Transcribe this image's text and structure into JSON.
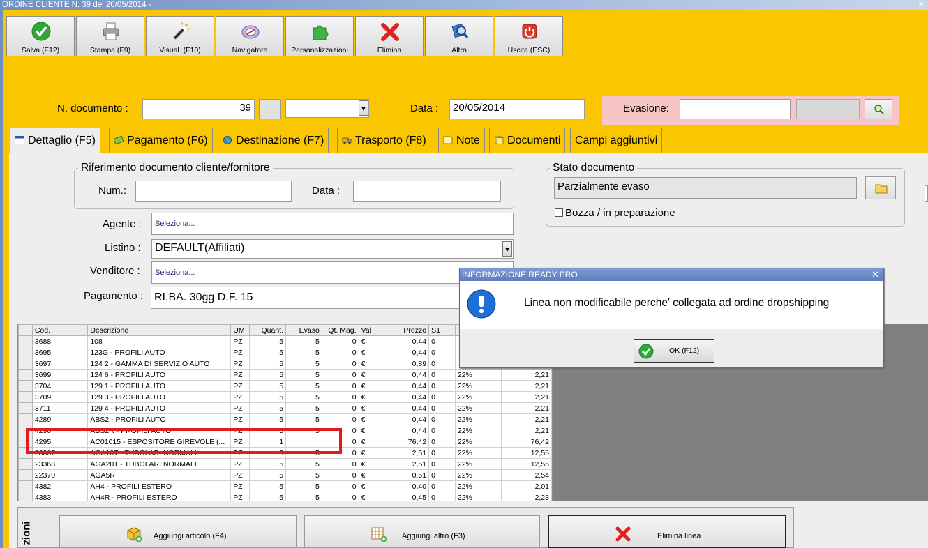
{
  "window": {
    "title": "ORDINE CLIENTE N. 39 del 20/05/2014 -",
    "close": "✕"
  },
  "toolbar": {
    "save": "Salva (F12)",
    "print": "Stampa (F9)",
    "view": "Visual. (F10)",
    "navigator": "Navigatore",
    "customize": "Personalizzazioni",
    "delete": "Elimina",
    "other": "Altro",
    "exit": "Uscita (ESC)"
  },
  "header": {
    "doc_number_label": "N. documento :",
    "doc_number_value": "39",
    "date_label": "Data :",
    "date_value": "20/05/2014",
    "evasion_label": "Evasione:",
    "evasion_value": ""
  },
  "tabs": [
    {
      "label": "Dettaglio (F5)"
    },
    {
      "label": "Pagamento (F6)"
    },
    {
      "label": "Destinazione (F7)"
    },
    {
      "label": "Trasporto (F8)"
    },
    {
      "label": "Note"
    },
    {
      "label": "Documenti"
    },
    {
      "label": "Campi aggiuntivi"
    }
  ],
  "detail": {
    "ref_group_title": "Riferimento documento cliente/fornitore",
    "ref_num_label": "Num.:",
    "ref_num_value": "",
    "ref_date_label": "Data :",
    "ref_date_value": "",
    "agent_label": "Agente :",
    "agent_value": "Seleziona...",
    "pricelist_label": "Listino :",
    "pricelist_value": "DEFAULT(Affiliati)",
    "seller_label": "Venditore :",
    "seller_value": "Seleziona...",
    "payment_label": "Pagamento :",
    "payment_value": "RI.BA. 30gg D.F. 15",
    "status_group_title": "Stato documento",
    "status_value": "Parzialmente evaso",
    "draft_label": "Bozza / in preparazione"
  },
  "grid": {
    "columns": [
      "Cod.",
      "Descrizione",
      "UM",
      "Quant.",
      "Evaso",
      "Qt. Mag.",
      "Val",
      "Prezzo",
      "S1",
      "",
      ""
    ],
    "rows": [
      [
        "3688",
        "108",
        "PZ",
        "5",
        "5",
        "0",
        "€",
        "0,44",
        "0",
        "",
        ""
      ],
      [
        "3695",
        "123G - PROFILI AUTO",
        "PZ",
        "5",
        "5",
        "0",
        "€",
        "0,44",
        "0",
        "",
        ""
      ],
      [
        "3697",
        "124 2 - GAMMA DI SERVIZIO AUTO",
        "PZ",
        "5",
        "5",
        "0",
        "€",
        "0,89",
        "0",
        "",
        ""
      ],
      [
        "3699",
        "124 6 - PROFILI AUTO",
        "PZ",
        "5",
        "5",
        "0",
        "€",
        "0,44",
        "0",
        "22%",
        "2,21"
      ],
      [
        "3704",
        "129 1 - PROFILI AUTO",
        "PZ",
        "5",
        "5",
        "0",
        "€",
        "0,44",
        "0",
        "22%",
        "2,21"
      ],
      [
        "3709",
        "129 3 - PROFILI AUTO",
        "PZ",
        "5",
        "5",
        "0",
        "€",
        "0,44",
        "0",
        "22%",
        "2,21"
      ],
      [
        "3711",
        "129 4 - PROFILI AUTO",
        "PZ",
        "5",
        "5",
        "0",
        "€",
        "0,44",
        "0",
        "22%",
        "2,21"
      ],
      [
        "4289",
        "ABS2 - PROFILI AUTO",
        "PZ",
        "5",
        "5",
        "0",
        "€",
        "0,44",
        "0",
        "22%",
        "2,21"
      ],
      [
        "4290",
        "ABS2R - PROFILI AUTO",
        "PZ",
        "5",
        "5",
        "0",
        "€",
        "0,44",
        "0",
        "22%",
        "2,21"
      ],
      [
        "4295",
        "AC01015 - ESPOSITORE  GIREVOLE (...",
        "PZ",
        "1",
        "",
        "0",
        "€",
        "76,42",
        "0",
        "22%",
        "76,42"
      ],
      [
        "23367",
        "AGA10T - TUBOLARI NORMALI",
        "PZ",
        "5",
        "5",
        "0",
        "€",
        "2,51",
        "0",
        "22%",
        "12,55"
      ],
      [
        "23368",
        "AGA20T - TUBOLARI NORMALI",
        "PZ",
        "5",
        "5",
        "0",
        "€",
        "2,51",
        "0",
        "22%",
        "12,55"
      ],
      [
        "22370",
        "AGA5R",
        "PZ",
        "5",
        "5",
        "0",
        "€",
        "0,51",
        "0",
        "22%",
        "2,54"
      ],
      [
        "4382",
        "AH4 - PROFILI ESTERO",
        "PZ",
        "5",
        "5",
        "0",
        "€",
        "0,40",
        "0",
        "22%",
        "2,01"
      ],
      [
        "4383",
        "AH4R - PROFILI ESTERO",
        "PZ",
        "5",
        "5",
        "0",
        "€",
        "0,45",
        "0",
        "22%",
        "2,23"
      ]
    ]
  },
  "dialog": {
    "title": "INFORMAZIONE READY PRO",
    "close": "✕",
    "message": "Linea non modificabile perche' collegata ad ordine dropshipping",
    "ok": "OK (F12)"
  },
  "bottom": {
    "side_label": "zioni",
    "add_article": "Aggiungi articolo (F4)",
    "add_other": "Aggiungi altro (F3)",
    "delete_line": "Elimina linea"
  }
}
